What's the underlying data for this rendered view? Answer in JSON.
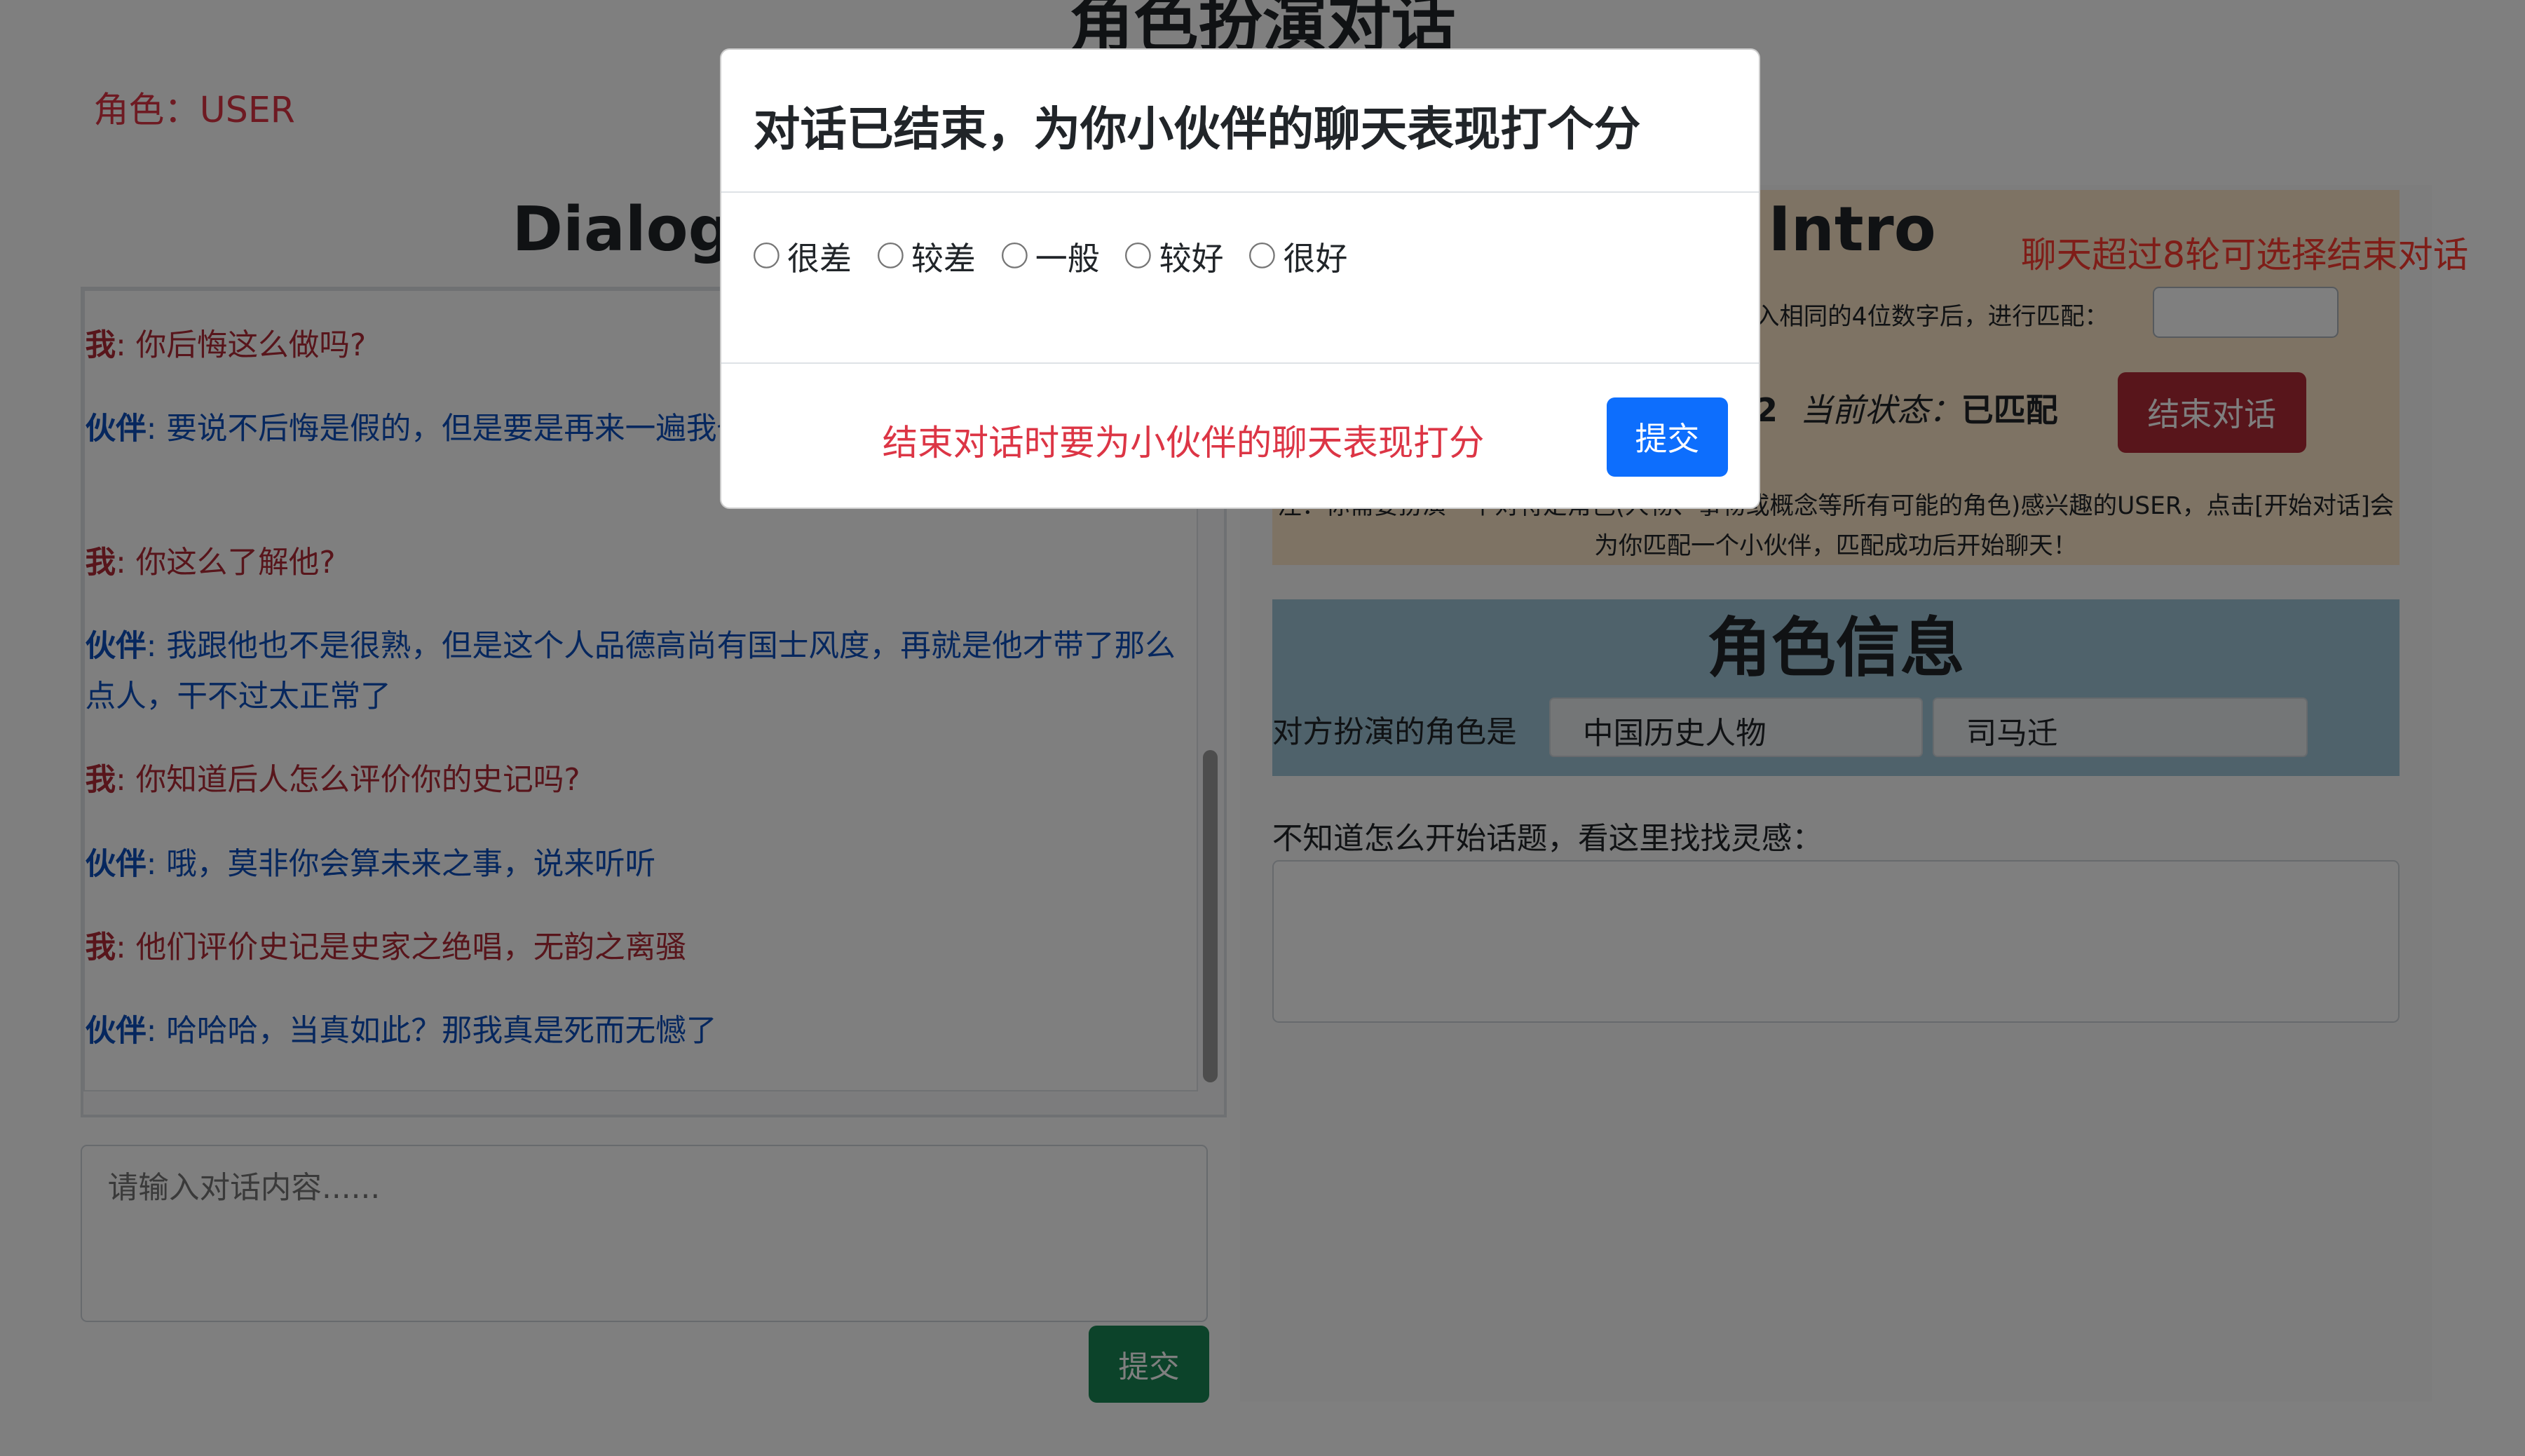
{
  "page": {
    "title": "角色扮演对话",
    "role_label": "角色：USER"
  },
  "dialog": {
    "heading": "Dialogue",
    "messages": [
      {
        "speaker": "我",
        "text": ": 你后悔这么做吗?",
        "type": "me"
      },
      {
        "speaker": "伙伴",
        "text": ": 要说不后悔是假的，但是要是再来一遍我也会这么做，因为李将军是好人啊",
        "type": "partner"
      },
      {
        "speaker": "我",
        "text": ": 你这么了解他?",
        "type": "me"
      },
      {
        "speaker": "伙伴",
        "text": ": 我跟他也不是很熟，但是这个人品德高尚有国士风度，再就是他才带了那么点人，干不过太正常了",
        "type": "partner"
      },
      {
        "speaker": "我",
        "text": ": 你知道后人怎么评价你的史记吗?",
        "type": "me"
      },
      {
        "speaker": "伙伴",
        "text": ": 哦，莫非你会算未来之事，说来听听",
        "type": "partner"
      },
      {
        "speaker": "我",
        "text": ": 他们评价史记是史家之绝唱，无韵之离骚",
        "type": "me"
      },
      {
        "speaker": "伙伴",
        "text": ": 哈哈哈，当真如此？那我真是死而无憾了",
        "type": "partner"
      }
    ],
    "input_placeholder": "请输入对话内容......",
    "submit_label": "提交"
  },
  "intro": {
    "title": "Intro",
    "hint": "聊天超过8轮可选择结束对话",
    "match_text": "入相同的4位数字后，进行匹配：",
    "room_number_partial": "2",
    "status_label": "当前状态：",
    "status_value": "已匹配",
    "end_button": "结束对话",
    "note": "注：你需要扮演一个对特定角色(人物、事物或概念等所有可能的角色)感兴趣的USER，点击[开始对话]会为你匹配一个小伙伴，匹配成功后开始聊天！"
  },
  "role_info": {
    "title": "角色信息",
    "partner_label": "对方扮演的角色是",
    "category": "中国历史人物",
    "name": "司马迁"
  },
  "inspiration": {
    "label": "不知道怎么开始话题，看这里找找灵感："
  },
  "modal": {
    "title": "对话已结束，为你小伙伴的聊天表现打个分",
    "options": [
      "很差",
      "较差",
      "一般",
      "较好",
      "很好"
    ],
    "hint": "结束对话时要为小伙伴的聊天表现打分",
    "submit_label": "提交"
  },
  "colors": {
    "primary": "#0d6efd",
    "danger": "#b02a37",
    "success": "#198754",
    "alert": "#ff3b30"
  }
}
